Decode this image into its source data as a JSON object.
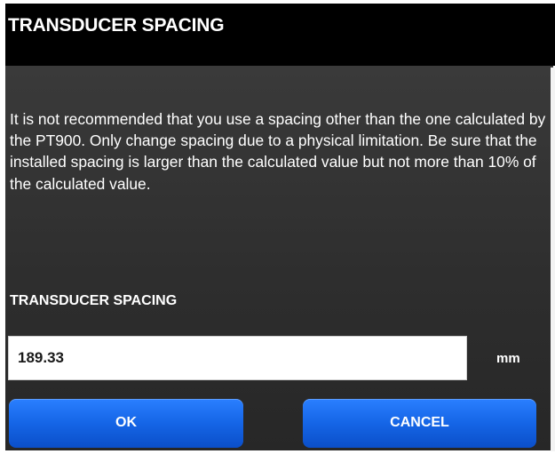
{
  "dialog": {
    "title": "TRANSDUCER SPACING",
    "message": "It is not recommended that you use a spacing other than the one calculated by the PT900. Only change spacing due to a physical limitation. Be sure that the installed spacing is larger than the calculated value but not more than 10% of the calculated value.",
    "field_label": "TRANSDUCER SPACING",
    "field_value": "189.33",
    "unit": "mm",
    "ok_label": "OK",
    "cancel_label": "CANCEL"
  },
  "colors": {
    "titlebar": "#000000",
    "dialog_background": "#333333",
    "button": "#1565e6",
    "text": "#ffffff"
  }
}
